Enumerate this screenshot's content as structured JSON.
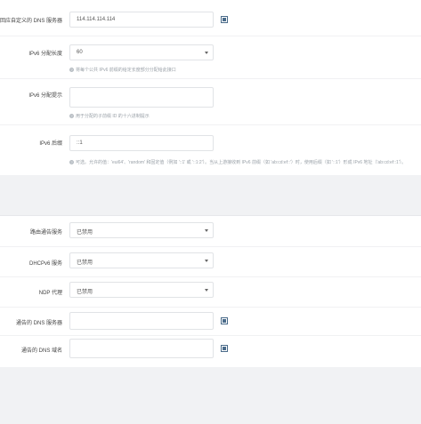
{
  "top_section": {
    "rows": [
      {
        "label": "回应自定义的 DNS 服务器",
        "value": "114.114.114.114",
        "type": "list"
      },
      {
        "label": "IPv6 分配长度",
        "value": "60",
        "type": "select",
        "hint": "将每个公共 IPv6 前缀的给定长度部分分配给此接口"
      },
      {
        "label": "IPv6 分配提示",
        "value": "",
        "type": "text",
        "hint": "用于分配的子前缀 ID 的十六进制提示"
      },
      {
        "label": "IPv6 后缀",
        "value": "::1",
        "type": "text",
        "hint": "可选。允许的值：'eui64'、'random' 和固定值（例如 '::1' 或 '::1:2'）。当从上游接收到 IPv6 前缀（如 'ab:cd:ef::'）时，使用后缀（如 '::1'）形成 IPv6 地址（'ab:cd:ef::1'）。"
      }
    ]
  },
  "bottom_section": {
    "rows": [
      {
        "label": "路由通告服务",
        "value": "已禁用",
        "type": "select"
      },
      {
        "label": "DHCPv6 服务",
        "value": "已禁用",
        "type": "select"
      },
      {
        "label": "NDP 代理",
        "value": "已禁用",
        "type": "select"
      },
      {
        "label": "通告的 DNS 服务器",
        "value": "",
        "type": "list"
      },
      {
        "label": "通告的 DNS 域名",
        "value": "",
        "type": "list"
      }
    ]
  },
  "icons": {
    "add": "add-list-icon",
    "hint": "question-icon",
    "dropdown": "chevron-down-icon"
  },
  "colors": {
    "background": "#f1f2f4",
    "panel": "#ffffff",
    "hint_text": "#9aa1a8",
    "icon_blue": "#4a6b8a"
  }
}
